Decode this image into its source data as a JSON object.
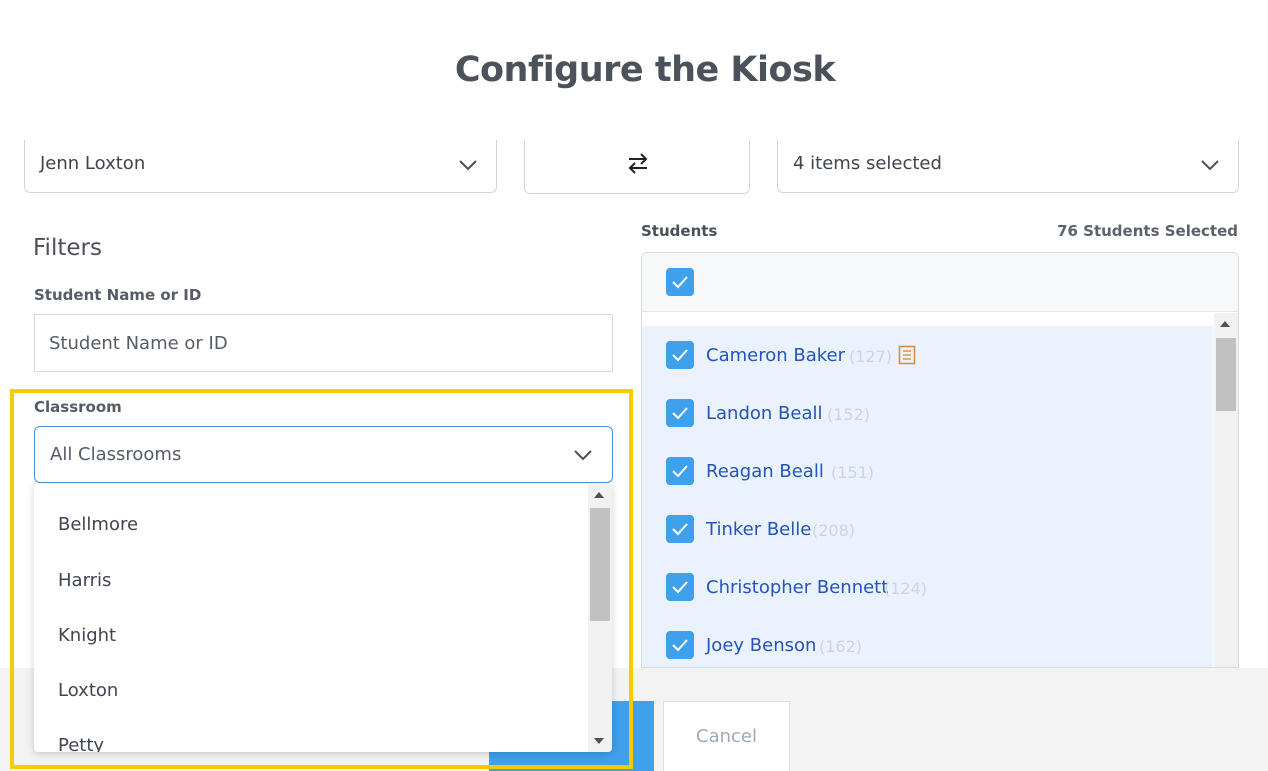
{
  "page": {
    "title": "Configure the Kiosk"
  },
  "top_row": {
    "teacher_value": "Jenn Loxton",
    "swap_glyph": "⇄",
    "items_value": "4 items selected"
  },
  "filters": {
    "title": "Filters",
    "student_label": "Student Name or ID",
    "student_placeholder": "Student Name or ID",
    "classroom_label": "Classroom",
    "classroom_value": "All Classrooms",
    "classroom_options": [
      "Bellmore",
      "Harris",
      "Knight",
      "Loxton",
      "Petty"
    ]
  },
  "students": {
    "label": "Students",
    "count_text": "76 Students Selected",
    "items": [
      {
        "name": "Cameron Baker",
        "id": "(127)",
        "note_icon": "notebook-icon"
      },
      {
        "name": "Landon Beall",
        "id": "(152)"
      },
      {
        "name": "Reagan Beall",
        "id": "(151)"
      },
      {
        "name": "Tinker Belle",
        "id": "(208)"
      },
      {
        "name": "Christopher Bennett",
        "id": "(124)"
      },
      {
        "name": "Joey Benson",
        "id": "(162)"
      }
    ]
  },
  "footer": {
    "cancel_label": "Cancel"
  },
  "colors": {
    "accent": "#3fa0ec",
    "link": "#2553b7",
    "highlight": "#f5cc00",
    "list_bg": "#eaf3fd",
    "note_icon": "#e08a3c"
  }
}
